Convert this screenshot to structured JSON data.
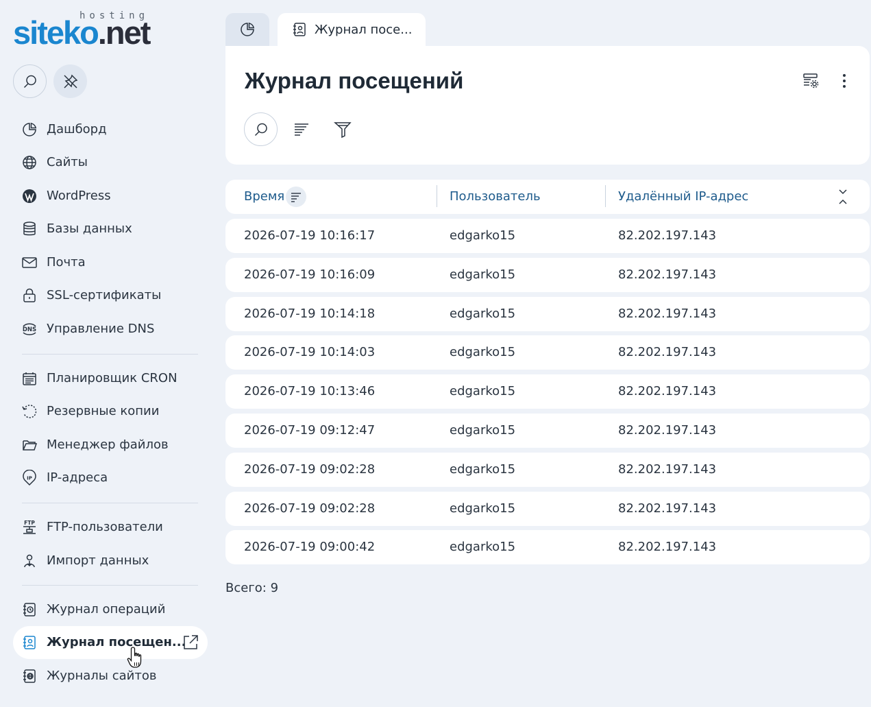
{
  "logo": {
    "main_part1": "siteko",
    "main_part2": ".net",
    "sub": "hosting"
  },
  "sidebar": {
    "items": [
      {
        "label": "Дашборд",
        "icon": "dashboard-icon"
      },
      {
        "label": "Сайты",
        "icon": "globe-icon"
      },
      {
        "label": "WordPress",
        "icon": "wordpress-icon"
      },
      {
        "label": "Базы данных",
        "icon": "database-icon"
      },
      {
        "label": "Почта",
        "icon": "mail-icon"
      },
      {
        "label": "SSL-сертификаты",
        "icon": "lock-icon"
      },
      {
        "label": "Управление DNS",
        "icon": "dns-icon"
      },
      {
        "label": "Планировщик CRON",
        "icon": "calendar-icon"
      },
      {
        "label": "Резервные копии",
        "icon": "backup-icon"
      },
      {
        "label": "Менеджер файлов",
        "icon": "folder-icon"
      },
      {
        "label": "IP-адреса",
        "icon": "ip-icon"
      },
      {
        "label": "FTP-пользователи",
        "icon": "ftp-icon"
      },
      {
        "label": "Импорт данных",
        "icon": "import-icon"
      },
      {
        "label": "Журнал операций",
        "icon": "operations-log-icon"
      },
      {
        "label": "Журнал посещен...",
        "icon": "visits-log-icon"
      },
      {
        "label": "Журналы сайтов",
        "icon": "site-logs-icon"
      }
    ]
  },
  "tabs": {
    "active_label": "Журнал посе..."
  },
  "header": {
    "title": "Журнал посещений"
  },
  "table": {
    "columns": [
      "Время",
      "Пользователь",
      "Удалённый IP-адрес"
    ],
    "rows": [
      [
        "2026-07-19 10:16:17",
        "edgarko15",
        "82.202.197.143"
      ],
      [
        "2026-07-19 10:16:09",
        "edgarko15",
        "82.202.197.143"
      ],
      [
        "2026-07-19 10:14:18",
        "edgarko15",
        "82.202.197.143"
      ],
      [
        "2026-07-19 10:14:03",
        "edgarko15",
        "82.202.197.143"
      ],
      [
        "2026-07-19 10:13:46",
        "edgarko15",
        "82.202.197.143"
      ],
      [
        "2026-07-19 09:12:47",
        "edgarko15",
        "82.202.197.143"
      ],
      [
        "2026-07-19 09:02:28",
        "edgarko15",
        "82.202.197.143"
      ],
      [
        "2026-07-19 09:02:28",
        "edgarko15",
        "82.202.197.143"
      ],
      [
        "2026-07-19 09:00:42",
        "edgarko15",
        "82.202.197.143"
      ]
    ]
  },
  "footer": {
    "total": "Всего: 9"
  },
  "colors": {
    "brand_blue": "#1a86cf",
    "header_text": "#1e5b8c",
    "background": "#eef2f8"
  }
}
